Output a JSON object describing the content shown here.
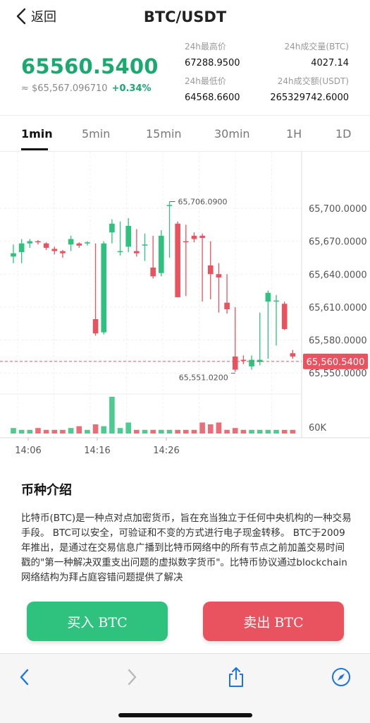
{
  "nav": {
    "back_label": "返回",
    "title": "BTC/USDT"
  },
  "ticker": {
    "last_price": "65560.5400",
    "usd_value": "≈ $65,567.096710",
    "change_pct": "+0.34%",
    "high_label": "24h最高价",
    "high_value": "67288.9500",
    "low_label": "24h最低价",
    "low_value": "64568.6600",
    "vol_btc_label": "24h成交量(BTC)",
    "vol_btc_value": "4027.14",
    "vol_usdt_label": "24h成交额(USDT)",
    "vol_usdt_value": "265329742.6000"
  },
  "tabs": [
    {
      "label": "1min",
      "active": true
    },
    {
      "label": "5min",
      "active": false
    },
    {
      "label": "15min",
      "active": false
    },
    {
      "label": "30min",
      "active": false
    },
    {
      "label": "1H",
      "active": false
    },
    {
      "label": "1D",
      "active": false
    }
  ],
  "chart_data": {
    "type": "candlestick",
    "y_ticks": [
      "65,700.0000",
      "65,670.0000",
      "65,640.0000",
      "65,610.0000",
      "65,580.0000",
      "65,550.0000"
    ],
    "y_tick_values": [
      65700,
      65670,
      65640,
      65610,
      65580,
      65550
    ],
    "ylim": [
      65536,
      65745
    ],
    "volume_tick": "60K",
    "x_ticks": [
      "14:06",
      "14:16",
      "14:26"
    ],
    "current_price_label": "65,560.5400",
    "current_price": 65560.54,
    "high_annotation": "65,706.0900",
    "high_value": 65706.09,
    "low_annotation": "65,551.0200",
    "low_value": 65551.02,
    "up_color": "#2ec27e",
    "down_color": "#e8535f",
    "candles": [
      {
        "o": 65656,
        "c": 65659,
        "h": 65667,
        "l": 65650,
        "v": 3
      },
      {
        "o": 65660,
        "c": 65668,
        "h": 65672,
        "l": 65650,
        "v": 2
      },
      {
        "o": 65668,
        "c": 65670,
        "h": 65672,
        "l": 65664,
        "v": 2
      },
      {
        "o": 65670,
        "c": 65669,
        "h": 65671,
        "l": 65667,
        "v": 3
      },
      {
        "o": 65668,
        "c": 65664,
        "h": 65669,
        "l": 65662,
        "v": 2
      },
      {
        "o": 65663,
        "c": 65661,
        "h": 65665,
        "l": 65658,
        "v": 2
      },
      {
        "o": 65661,
        "c": 65659,
        "h": 65662,
        "l": 65655,
        "v": 2
      },
      {
        "o": 65667,
        "c": 65672,
        "h": 65675,
        "l": 65661,
        "v": 3
      },
      {
        "o": 65668,
        "c": 65666,
        "h": 65669,
        "l": 65664,
        "v": 4
      },
      {
        "o": 65668,
        "c": 65669,
        "h": 65670,
        "l": 65666,
        "v": 2
      },
      {
        "o": 65599,
        "c": 65586,
        "h": 65668,
        "l": 65584,
        "v": 5
      },
      {
        "o": 65587,
        "c": 65668,
        "h": 65670,
        "l": 65585,
        "v": 4
      },
      {
        "o": 65678,
        "c": 65686,
        "h": 65690,
        "l": 65668,
        "v": 20
      },
      {
        "o": 65660,
        "c": 65661,
        "h": 65688,
        "l": 65657,
        "v": 3
      },
      {
        "o": 65665,
        "c": 65684,
        "h": 65691,
        "l": 65660,
        "v": 6
      },
      {
        "o": 65661,
        "c": 65659,
        "h": 65681,
        "l": 65656,
        "v": 2
      },
      {
        "o": 65666,
        "c": 65667,
        "h": 65677,
        "l": 65652,
        "v": 2
      },
      {
        "o": 65646,
        "c": 65638,
        "h": 65675,
        "l": 65636,
        "v": 2
      },
      {
        "o": 65641,
        "c": 65675,
        "h": 65680,
        "l": 65638,
        "v": 2
      },
      {
        "o": 65702,
        "c": 65703,
        "h": 65706,
        "l": 65655,
        "v": 2
      },
      {
        "o": 65686,
        "c": 65619,
        "h": 65688,
        "l": 65619,
        "v": 2
      },
      {
        "o": 65670,
        "c": 65669,
        "h": 65685,
        "l": 65620,
        "v": 2
      },
      {
        "o": 65675,
        "c": 65672,
        "h": 65678,
        "l": 65669,
        "v": 2
      },
      {
        "o": 65675,
        "c": 65673,
        "h": 65677,
        "l": 65615,
        "v": 6
      },
      {
        "o": 65648,
        "c": 65640,
        "h": 65670,
        "l": 65617,
        "v": 5
      },
      {
        "o": 65640,
        "c": 65637,
        "h": 65650,
        "l": 65605,
        "v": 6
      },
      {
        "o": 65614,
        "c": 65608,
        "h": 65640,
        "l": 65604,
        "v": 2
      },
      {
        "o": 65565,
        "c": 65553,
        "h": 65610,
        "l": 65551,
        "v": 3
      },
      {
        "o": 65562,
        "c": 65561,
        "h": 65566,
        "l": 65558,
        "v": 2
      },
      {
        "o": 65556,
        "c": 65562,
        "h": 65566,
        "l": 65553,
        "v": 2
      },
      {
        "o": 65560,
        "c": 65562,
        "h": 65605,
        "l": 65557,
        "v": 2
      },
      {
        "o": 65615,
        "c": 65623,
        "h": 65625,
        "l": 65563,
        "v": 2
      },
      {
        "o": 65615,
        "c": 65616,
        "h": 65621,
        "l": 65575,
        "v": 2
      },
      {
        "o": 65613,
        "c": 65590,
        "h": 65615,
        "l": 65589,
        "v": 2
      },
      {
        "o": 65568,
        "c": 65565,
        "h": 65571,
        "l": 65563,
        "v": 2
      }
    ]
  },
  "intro": {
    "title": "币种介绍",
    "body": "比特币(BTC)是一种点对点加密货币，旨在充当独立于任何中央机构的一种交易手段。 BTC可以安全，可验证和不变的方式进行电子现金转移。 BTC于2009年推出，是通过在交易信息广播到比特币网络中的所有节点之前加盖交易时间戳的\"第一种解决双重支出问题的虚拟数字货币\"。比特币协议通过blockchain网络结构为拜占庭容错问题提供了解决"
  },
  "actions": {
    "buy_label": "买入 BTC",
    "sell_label": "卖出 BTC",
    "buy_color": "#2ec27e",
    "sell_color": "#e8535f"
  },
  "browser": {
    "icons": [
      "back-icon",
      "forward-icon",
      "share-icon",
      "compass-icon"
    ]
  }
}
